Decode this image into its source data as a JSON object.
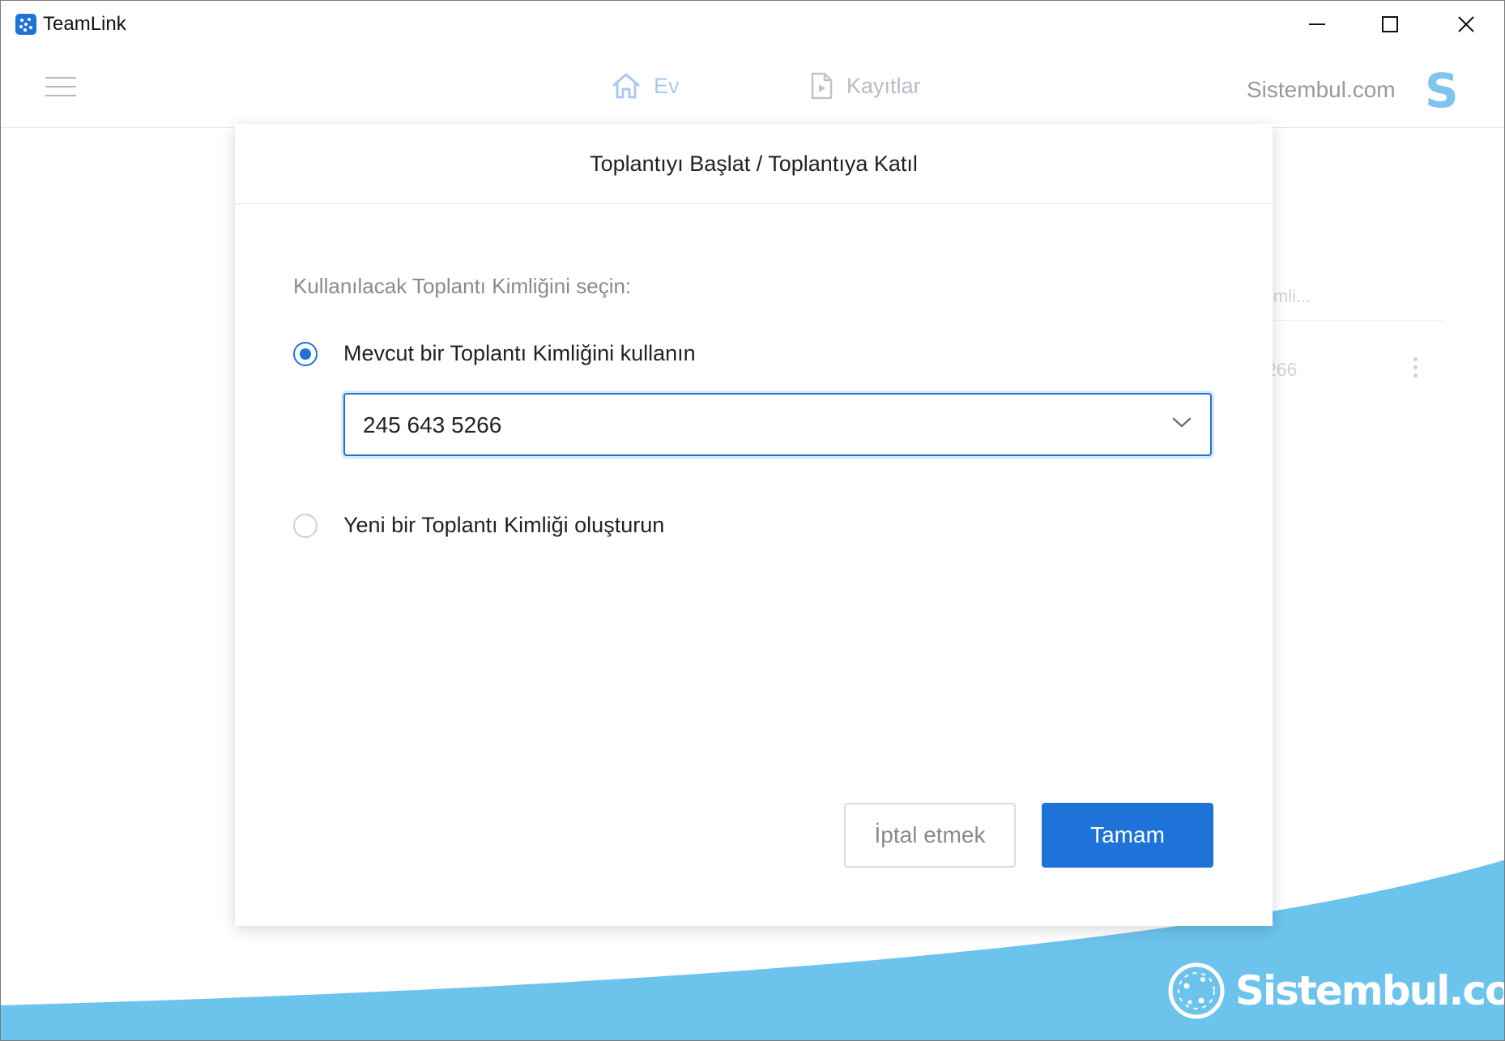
{
  "window": {
    "title": "TeamLink"
  },
  "nav": {
    "home_label": "Ev",
    "recordings_label": "Kayıtlar",
    "user_name": "Sistembul.com",
    "avatar_letter": "S"
  },
  "background_list": {
    "hint_text": "imli...",
    "item_id": "266"
  },
  "dialog": {
    "title": "Toplantıyı Başlat / Toplantıya Katıl",
    "prompt": "Kullanılacak Toplantı Kimliğini seçin:",
    "option_existing_label": "Mevcut bir Toplantı Kimliğini kullanın",
    "option_existing_selected": true,
    "selected_meeting_id": "245 643 5266",
    "option_new_label": "Yeni bir Toplantı Kimliği oluşturun",
    "option_new_selected": false,
    "cancel_label": "İptal etmek",
    "ok_label": "Tamam"
  },
  "watermark": {
    "text": "Sistembul.com"
  },
  "colors": {
    "accent": "#1e73d8",
    "wave": "#6cc3ec"
  }
}
